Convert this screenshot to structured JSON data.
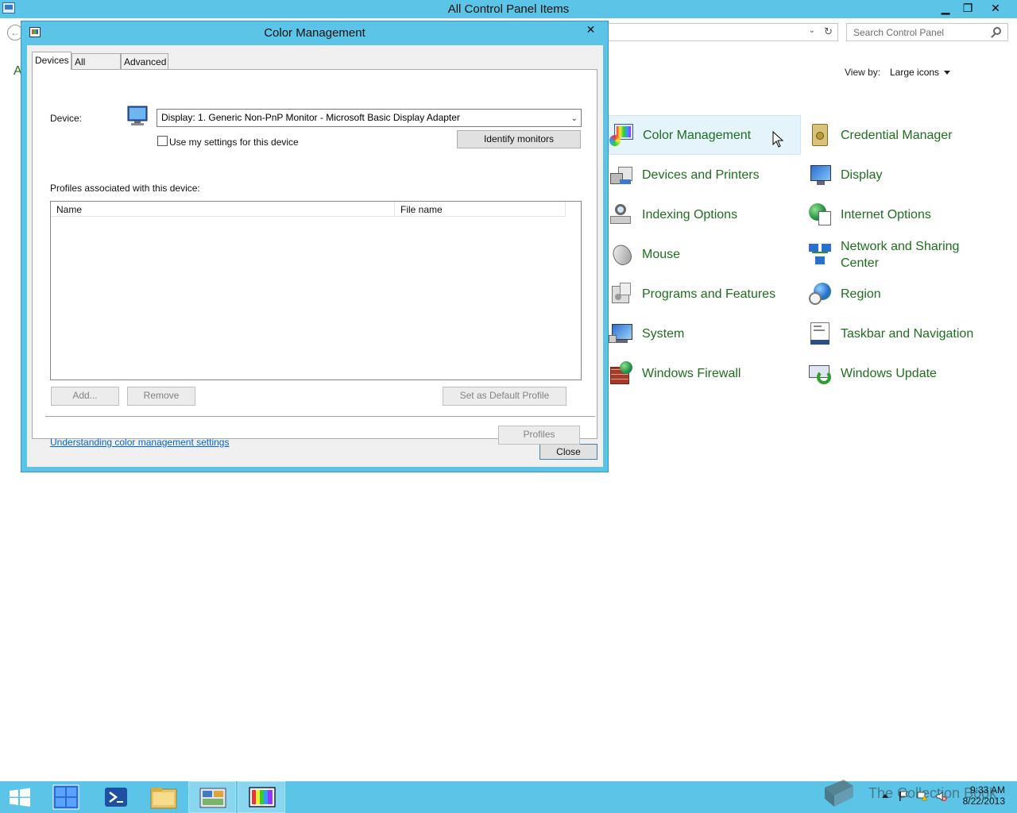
{
  "window": {
    "title": "All Control Panel Items",
    "minimize_glyph": "▁",
    "maximize_glyph": "❐",
    "close_glyph": "✕"
  },
  "address": {
    "back_glyph": "←",
    "dropdown_glyph": "⌄",
    "refresh_glyph": "↻"
  },
  "search": {
    "placeholder": "Search Control Panel"
  },
  "view_by": {
    "label": "View by:",
    "value": "Large icons"
  },
  "left_fragment": {
    "letter": "A"
  },
  "control_panel_items": [
    {
      "label": "Color Management",
      "icon": "color-management-icon"
    },
    {
      "label": "Credential Manager",
      "icon": "credential-manager-icon"
    },
    {
      "label": "Devices and Printers",
      "icon": "devices-printers-icon"
    },
    {
      "label": "Display",
      "icon": "display-icon"
    },
    {
      "label": "Indexing Options",
      "icon": "indexing-icon"
    },
    {
      "label": "Internet Options",
      "icon": "internet-options-icon"
    },
    {
      "label": "Mouse",
      "icon": "mouse-icon"
    },
    {
      "label": "Network and Sharing Center",
      "icon": "network-icon"
    },
    {
      "label": "Programs and Features",
      "icon": "programs-icon"
    },
    {
      "label": "Region",
      "icon": "region-icon"
    },
    {
      "label": "System",
      "icon": "system-icon"
    },
    {
      "label": "Taskbar and Navigation",
      "icon": "taskbar-icon"
    },
    {
      "label": "Windows Firewall",
      "icon": "firewall-icon"
    },
    {
      "label": "Windows Update",
      "icon": "windows-update-icon"
    }
  ],
  "dialog": {
    "title": "Color Management",
    "close_glyph": "✕",
    "tabs": [
      {
        "label": "Devices",
        "active": true
      },
      {
        "label": "All Profiles",
        "active": false
      },
      {
        "label": "Advanced",
        "active": false
      }
    ],
    "device_label": "Device:",
    "device_value": "Display: 1. Generic Non-PnP Monitor - Microsoft Basic Display Adapter",
    "use_settings_label": "Use my settings for this device",
    "use_settings_checked": false,
    "identify_button": "Identify monitors",
    "profiles_heading": "Profiles associated with this device:",
    "table_headers": [
      "Name",
      "File name"
    ],
    "table_rows": [],
    "add_button": "Add...",
    "remove_button": "Remove",
    "set_default_button": "Set as Default Profile",
    "profiles_button": "Profiles",
    "link_text": "Understanding color management settings",
    "close_button": "Close"
  },
  "taskbar": {
    "time": "9:33 AM",
    "date": "8/22/2013",
    "watermark": "The Collection Book"
  },
  "colors": {
    "accent": "#5bc4e7",
    "item_text": "#1e6e1e",
    "link": "#0066cc"
  }
}
